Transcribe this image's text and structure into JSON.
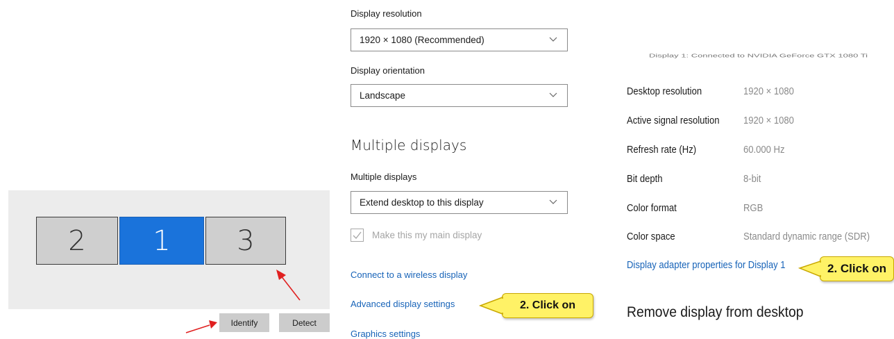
{
  "arrangement": {
    "monitors": [
      {
        "label": "2",
        "selected": false
      },
      {
        "label": "1",
        "selected": true
      },
      {
        "label": "3",
        "selected": false
      }
    ],
    "identify_label": "Identify",
    "detect_label": "Detect"
  },
  "display": {
    "resolution_label": "Display resolution",
    "resolution_value": "1920 × 1080 (Recommended)",
    "orientation_label": "Display orientation",
    "orientation_value": "Landscape",
    "multiple_heading": "Multiple displays",
    "multiple_label": "Multiple displays",
    "multiple_value": "Extend desktop to this display",
    "main_display_label": "Make this my main display",
    "main_display_checked": true,
    "links": {
      "wireless": "Connect to a wireless display",
      "advanced": "Advanced display settings",
      "graphics": "Graphics settings"
    }
  },
  "advanced": {
    "title": "Display 1: Connected to NVIDIA GeForce GTX 1080 Ti",
    "properties": [
      {
        "name": "Desktop resolution",
        "value": "1920 × 1080"
      },
      {
        "name": "Active signal resolution",
        "value": "1920 × 1080"
      },
      {
        "name": "Refresh rate (Hz)",
        "value": "60.000 Hz"
      },
      {
        "name": "Bit depth",
        "value": "8-bit"
      },
      {
        "name": "Color format",
        "value": "RGB"
      },
      {
        "name": "Color space",
        "value": "Standard dynamic range (SDR)"
      }
    ],
    "adapter_link": "Display adapter properties for Display 1",
    "remove_heading": "Remove display from desktop"
  },
  "annotations": {
    "callout_advanced": "2. Click on",
    "callout_adapter": "2. Click on"
  },
  "colors": {
    "accent": "#1a73db",
    "link": "#1763b8",
    "callout_fill": "#fff266",
    "arrow_red": "#e02020"
  }
}
